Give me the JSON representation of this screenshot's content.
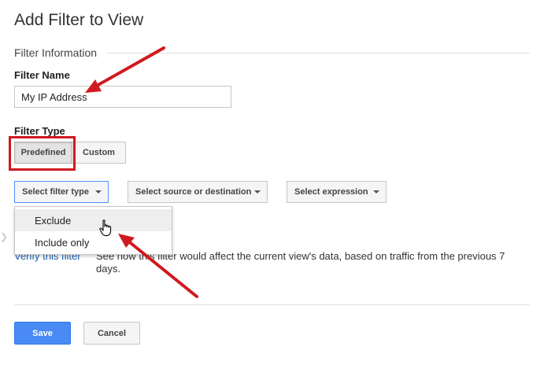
{
  "page": {
    "title": "Add Filter to View",
    "section_title": "Filter Information"
  },
  "filter_name": {
    "label": "Filter Name",
    "value": "My IP Address"
  },
  "filter_type": {
    "label": "Filter Type",
    "tabs": [
      {
        "label": "Predefined",
        "selected": true
      },
      {
        "label": "Custom",
        "selected": false
      }
    ]
  },
  "dropdowns": {
    "filter_type": "Select filter type",
    "source": "Select source or destination",
    "expression": "Select expression"
  },
  "filter_type_menu": {
    "items": [
      {
        "label": "Exclude",
        "hovered": true
      },
      {
        "label": "Include only",
        "hovered": false
      }
    ]
  },
  "verify": {
    "link": "Verify this filter",
    "description": "See how this filter would affect the current view's data, based on traffic from the previous 7 days."
  },
  "actions": {
    "save": "Save",
    "cancel": "Cancel"
  },
  "colors": {
    "annotation_red": "#d0191f",
    "primary_blue": "#4a8af4",
    "link_blue": "#1a5fb4"
  },
  "icons": {
    "cursor": "hand-pointer-icon",
    "dropdown": "caret-down-icon"
  }
}
